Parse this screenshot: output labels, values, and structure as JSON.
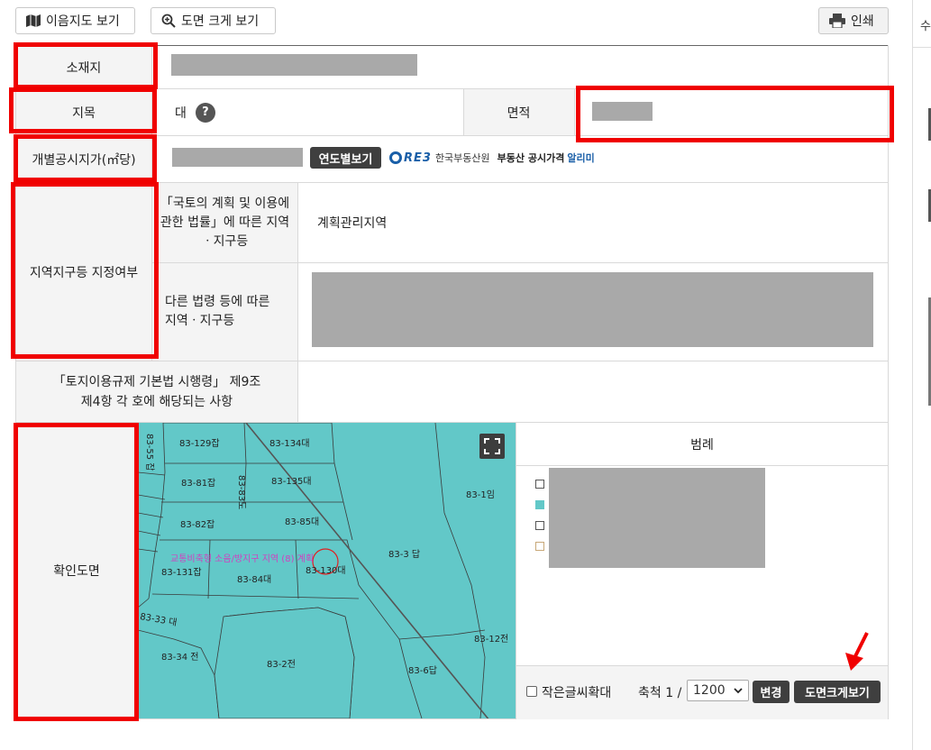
{
  "toolbar": {
    "land_use_map_label": "이음지도 보기",
    "zoom_map_label": "도면 크게 보기",
    "print_label": "인쇄"
  },
  "rows": {
    "location_label": "소재지",
    "jimok_label": "지목",
    "jimok_value": "대",
    "area_label": "면적",
    "price_label": "개별공시지가(㎡당)",
    "year_button_label": "연도별보기",
    "reb_logo_text": "RE3",
    "reb_org_text": "한국부동산원",
    "reb_service_text": "부동산 공시가격",
    "reb_alimi_text": "알리미",
    "zone_label": "지역지구등 지정여부",
    "zone_national_label": "「국토의 계획 및 이용에 관한 법률」에 따른 지역ㆍ지구등",
    "zone_national_value": "계획관리지역",
    "zone_other_label": "다른 법령 등에 따른 지역ㆍ지구등",
    "enforcement_label": "「토지이용규제 기본법 시행령」 제9조 제4항 각 호에 해당되는 사항",
    "map_label": "확인도면"
  },
  "legend": {
    "title": "범례",
    "colors": {
      "teal": "#62c8c8",
      "tan": "#c8a878"
    }
  },
  "controls": {
    "small_text_label": "작은글씨확대",
    "scale_label": "축척 1 /",
    "scale_value": "1200",
    "change_label": "변경",
    "big_map_label": "도면크게보기"
  },
  "map": {
    "parcels": [
      "83-129잡",
      "83-134대",
      "83-55 잡",
      "83-81잡",
      "83-135대",
      "83-83도",
      "83-1임",
      "83-82잡",
      "83-85대",
      "83-131잡",
      "83-84대",
      "83-130대",
      "83-3 답",
      "83-33 대",
      "83-34 전",
      "83-2전",
      "83-6답",
      "83-12전"
    ],
    "overlay_text": "교통비축형 소음/방지구 지역 (8) 계획"
  },
  "colors": {
    "highlight_red": "#f00000",
    "map_teal": "#62c8c8",
    "redacted_gray": "#a9a9a9"
  }
}
